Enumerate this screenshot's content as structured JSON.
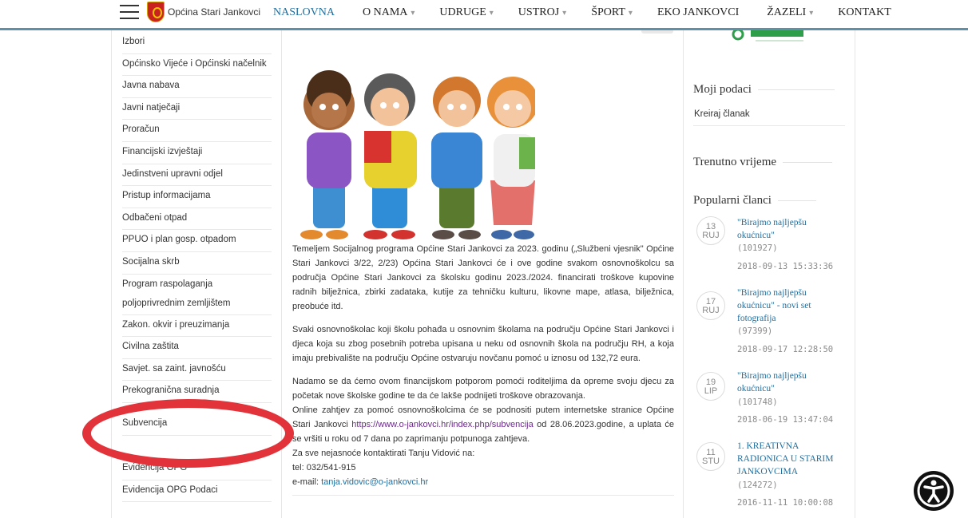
{
  "header": {
    "site_name": "Općina Stari Jankovci",
    "nav": [
      {
        "label": "NASLOVNA",
        "caret": ""
      },
      {
        "label": "O NAMA",
        "caret": "▾"
      },
      {
        "label": "UDRUGE",
        "caret": "▾"
      },
      {
        "label": "USTROJ",
        "caret": "▾"
      },
      {
        "label": "ŠPORT",
        "caret": "▾"
      },
      {
        "label": "EKO JANKOVCI",
        "caret": ""
      },
      {
        "label": "ŽAZELI",
        "caret": "▾"
      },
      {
        "label": "KONTAKT",
        "caret": ""
      }
    ]
  },
  "sidebar": {
    "items": [
      "Izbori",
      "Općinsko Vijeće i Općinski načelnik",
      "Javna nabava",
      "Javni natječaji",
      "Proračun",
      "Financijski izvještaji",
      "Jedinstveni upravni odjel",
      "Pristup informacijama",
      "Odbačeni otpad",
      "PPUO i plan gosp. otpadom",
      "Socijalna skrb",
      "Program raspolaganja poljoprivrednim zemljištem",
      "Zakon. okvir i preuzimanja",
      "Civilna zaštita",
      "Savjet. sa zaint. javnošću",
      "Prekogranična suradnja",
      "",
      "Subvencija",
      "Evidencija OPG",
      "Evidencija OPG Podaci"
    ]
  },
  "article": {
    "p1": "Temeljem Socijalnog programa Općine Stari Jankovci za 2023. godinu („Službeni vjesnik\" Općine Stari Jankovci 3/22, 2/23) Općina Stari Jankovci će i ove godine svakom osnovnoškolcu sa područja Općine Stari Jankovci za školsku godinu 2023./2024. financirati troškove kupovine radnih bilježnica, zbirki zadataka, kutije za tehničku kulturu, likovne mape, atlasa, bilježnica, preobuće itd.",
    "p2": "Svaki osnovnoškolac koji školu pohađa u  osnovnim školama na području Općine Stari Jankovci i djeca koja su zbog posebnih potreba upisana u neku od osnovnih škola na području RH, a koja imaju prebivalište na području Općine ostvaruju novčanu pomoć u iznosu od 132,72 eura.",
    "p3": "Nadamo se da ćemo ovom financijskom potporom pomoći roditeljima da opreme svoju djecu za početak nove školske godine te da će lakše podnijeti troškove obrazovanja.",
    "p4_before": "Online zahtjev za pomoć osnovnoškolcima će se podnositi putem internetske stranice Općine Stari Jankovci ",
    "p4_link": "https://www.o-jankovci.hr/index.php/subvencija",
    "p4_after": " od 28.06.2023.godine, a uplata će se vršiti u roku od 7 dana po zaprimanju potpunoga zahtjeva.",
    "contact_intro": "Za sve nejasnoće kontaktirati Tanju Vidović na:",
    "tel": "tel: 032/541-915",
    "email_label": "e-mail: ",
    "email": "tanja.vidovic@o-jankovci.hr"
  },
  "right": {
    "moji_podaci": "Moji podaci",
    "kreiraj": "Kreiraj članak",
    "trenutno_vrijeme": "Trenutno vrijeme",
    "popularni": "Popularni članci",
    "popular": [
      {
        "day": "13",
        "month": "RUJ",
        "title": "\"Birajmo najljepšu okućnicu\"",
        "count": "(101927)",
        "date": "2018-09-13 15:33:36"
      },
      {
        "day": "17",
        "month": "RUJ",
        "title": "\"Birajmo najljepšu okućnicu\" - novi set fotografija",
        "count": "(97399)",
        "date": "2018-09-17 12:28:50"
      },
      {
        "day": "19",
        "month": "LIP",
        "title": "\"Birajmo najljepšu okućnicu\"",
        "count": "(101748)",
        "date": "2018-06-19 13:47:04"
      },
      {
        "day": "11",
        "month": "STU",
        "title": "1. KREATIVNA RADIONICA U STARIM JANKOVCIMA",
        "count": "(124272)",
        "date": "2016-11-11 10:00:08"
      }
    ]
  },
  "colors": {
    "accent": "#1f6fa0",
    "header_border": "#5f8fa9",
    "highlight_ellipse": "#e2333a"
  }
}
